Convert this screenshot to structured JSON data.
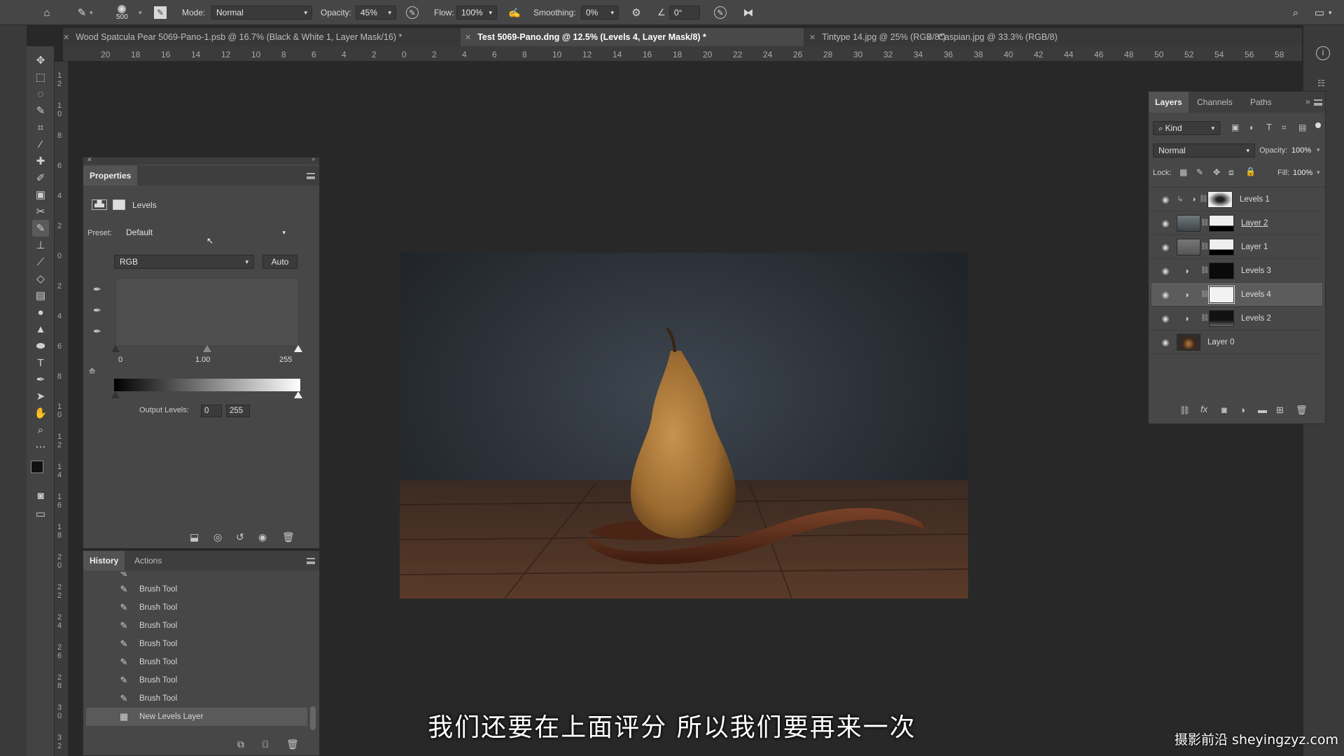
{
  "options_bar": {
    "brush_size": "500",
    "mode_label": "Mode:",
    "mode_value": "Normal",
    "opacity_label": "Opacity:",
    "opacity_value": "45%",
    "flow_label": "Flow:",
    "flow_value": "100%",
    "smoothing_label": "Smoothing:",
    "smoothing_value": "0%",
    "angle_value": "0°"
  },
  "tabs": [
    {
      "label": "Wood Spatcula Pear 5069-Pano-1.psb @ 16.7% (Black & White 1, Layer Mask/16) *"
    },
    {
      "label": "Test 5069-Pano.dng @ 12.5% (Levels 4, Layer Mask/8) *"
    },
    {
      "label": "Tintype 14.jpg @ 25% (RGB/8*)"
    },
    {
      "label": "Caspian.jpg @ 33.3% (RGB/8)"
    }
  ],
  "ruler_h": [
    "20",
    "18",
    "16",
    "14",
    "12",
    "10",
    "8",
    "6",
    "4",
    "2",
    "0",
    "2",
    "4",
    "6",
    "8",
    "10",
    "12",
    "14",
    "16",
    "18",
    "20",
    "22",
    "24",
    "26",
    "28",
    "30",
    "32",
    "34",
    "36",
    "38",
    "40",
    "42",
    "44",
    "46",
    "48",
    "50",
    "52",
    "54",
    "56",
    "58"
  ],
  "ruler_v": [
    "1 2",
    "1 0",
    "8",
    "6",
    "4",
    "2",
    "0",
    "2",
    "4",
    "6",
    "8",
    "1 0",
    "1 2",
    "1 4",
    "1 6",
    "1 8",
    "2 0",
    "2 2",
    "2 4",
    "2 6",
    "2 8",
    "3 0",
    "3 2"
  ],
  "properties": {
    "tab_label": "Properties",
    "adjustment_label": "Levels",
    "preset_label": "Preset:",
    "preset_value": "Default",
    "channel_value": "RGB",
    "auto_label": "Auto",
    "input_black": "0",
    "input_gamma": "1.00",
    "input_white": "255",
    "output_label": "Output Levels:",
    "output_black": "0",
    "output_white": "255"
  },
  "history": {
    "tab_history": "History",
    "tab_actions": "Actions",
    "items": [
      {
        "label": "Brush Tool"
      },
      {
        "label": "Brush Tool"
      },
      {
        "label": "Brush Tool"
      },
      {
        "label": "Brush Tool"
      },
      {
        "label": "Brush Tool"
      },
      {
        "label": "Brush Tool"
      },
      {
        "label": "Brush Tool"
      },
      {
        "label": "New Levels Layer"
      }
    ]
  },
  "layers_panel": {
    "tab_layers": "Layers",
    "tab_channels": "Channels",
    "tab_paths": "Paths",
    "kind_label": "Kind",
    "blend_mode": "Normal",
    "opacity_label": "Opacity:",
    "opacity_value": "100%",
    "lock_label": "Lock:",
    "fill_label": "Fill:",
    "fill_value": "100%",
    "layers": [
      {
        "name": "Levels 1"
      },
      {
        "name": "Layer 2"
      },
      {
        "name": "Layer 1"
      },
      {
        "name": "Levels 3"
      },
      {
        "name": "Levels 4"
      },
      {
        "name": "Levels 2"
      },
      {
        "name": "Layer 0"
      }
    ]
  },
  "subtitle": "我们还要在上面评分 所以我们要再来一次",
  "watermark": "摄影前沿 sheyingzyz.com",
  "colors": {
    "app_bg": "#282828",
    "panel_bg": "#474747",
    "selected_layer": "#5c5c5c"
  }
}
